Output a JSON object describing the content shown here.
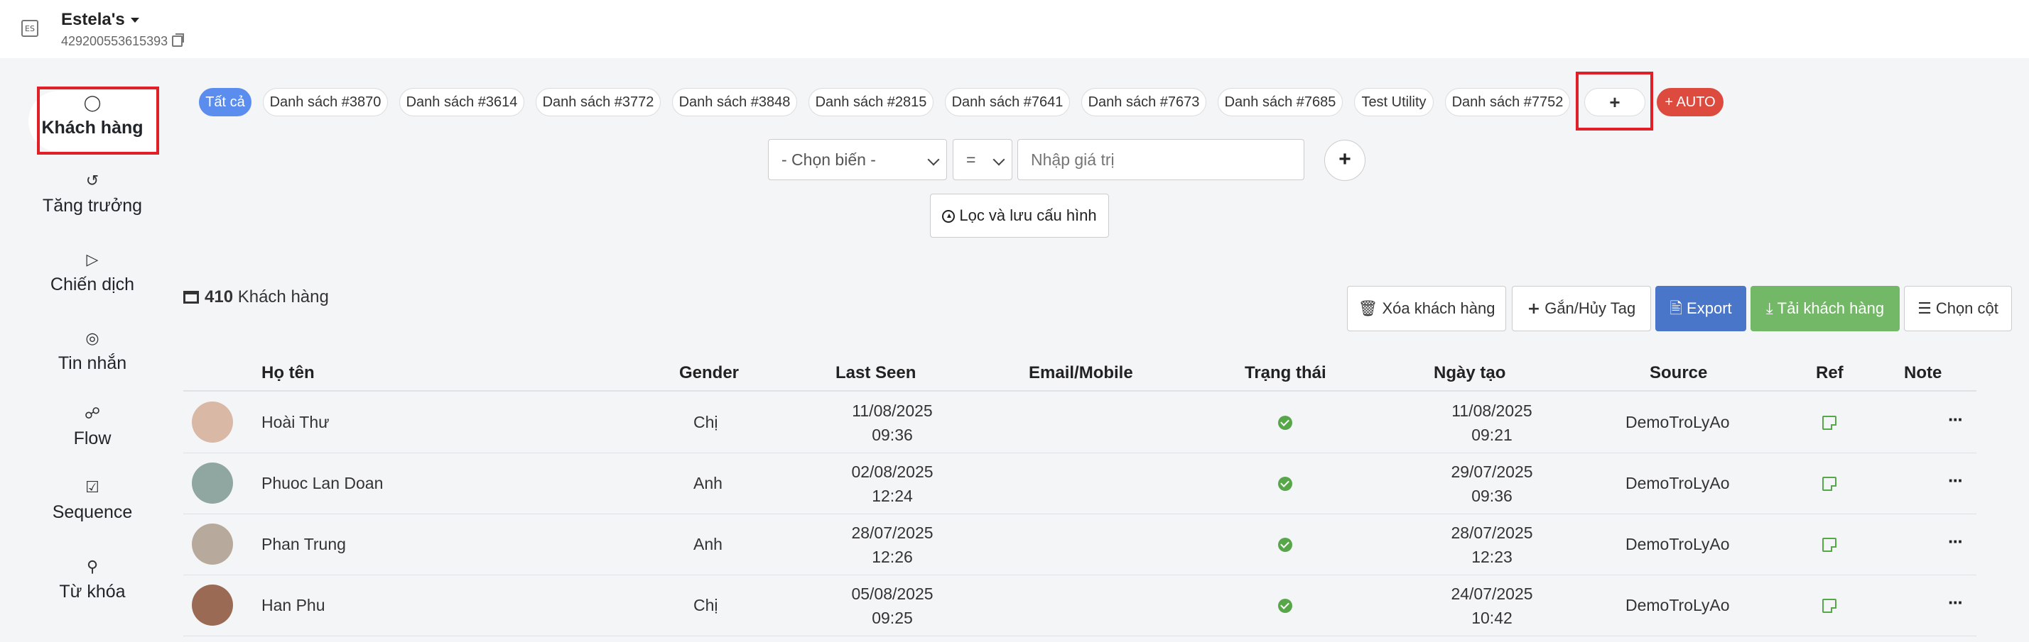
{
  "header": {
    "page_name": "Estela's",
    "page_id": "429200553615393"
  },
  "sidebar": {
    "items": [
      {
        "label": "Khách hàng",
        "icon": "user-icon"
      },
      {
        "label": "Tăng trưởng",
        "icon": "growth-icon"
      },
      {
        "label": "Chiến dịch",
        "icon": "send-icon"
      },
      {
        "label": "Tin nhắn",
        "icon": "message-icon"
      },
      {
        "label": "Flow",
        "icon": "flow-icon"
      },
      {
        "label": "Sequence",
        "icon": "calendar-check-icon"
      },
      {
        "label": "Từ khóa",
        "icon": "key-icon"
      }
    ]
  },
  "tags": [
    "Tất cả",
    "Danh sách #3870",
    "Danh sách #3614",
    "Danh sách #3772",
    "Danh sách #3848",
    "Danh sách #2815",
    "Danh sách #7641",
    "Danh sách #7673",
    "Danh sách #7685",
    "Test Utility",
    "Danh sách #7752"
  ],
  "tag_add_label": "+",
  "auto_label": "+ AUTO",
  "filter": {
    "variable_select": "- Chọn biến -",
    "operator_select": "=",
    "value_placeholder": "Nhập giá trị",
    "add_label": "+",
    "save_label": "Lọc và lưu cấu hình"
  },
  "summary": {
    "count": "410",
    "label": "Khách hàng"
  },
  "actions": {
    "delete": "Xóa khách hàng",
    "tag": "Gắn/Hủy Tag",
    "export": "Export",
    "download": "Tải khách hàng",
    "columns": "Chọn cột"
  },
  "table": {
    "headers": [
      "Họ tên",
      "Gender",
      "Last Seen",
      "Email/Mobile",
      "Trạng thái",
      "Ngày tạo",
      "Source",
      "Ref",
      "Note"
    ],
    "rows": [
      {
        "name": "Hoài Thư",
        "gender": "Chị",
        "last_seen_date": "11/08/2025",
        "last_seen_time": "09:36",
        "email": "",
        "created_date": "11/08/2025",
        "created_time": "09:21",
        "source": "DemoTroLyAo",
        "avatar_color": "#d9b8a6"
      },
      {
        "name": "Phuoc Lan Doan",
        "gender": "Anh",
        "last_seen_date": "02/08/2025",
        "last_seen_time": "12:24",
        "email": "",
        "created_date": "29/07/2025",
        "created_time": "09:36",
        "source": "DemoTroLyAo",
        "avatar_color": "#8fa7a0"
      },
      {
        "name": "Phan Trung",
        "gender": "Anh",
        "last_seen_date": "28/07/2025",
        "last_seen_time": "12:26",
        "email": "",
        "created_date": "28/07/2025",
        "created_time": "12:23",
        "source": "DemoTroLyAo",
        "avatar_color": "#b7aa9c"
      },
      {
        "name": "Han Phu",
        "gender": "Chị",
        "last_seen_date": "05/08/2025",
        "last_seen_time": "09:25",
        "email": "",
        "created_date": "24/07/2025",
        "created_time": "10:42",
        "source": "DemoTroLyAo",
        "avatar_color": "#9a6a55"
      }
    ]
  },
  "colors": {
    "accent_red": "#e01f26",
    "status_green": "#57a64a",
    "pill_blue": "#5b8def",
    "export_blue": "#4a76c9",
    "download_green": "#72b866"
  }
}
